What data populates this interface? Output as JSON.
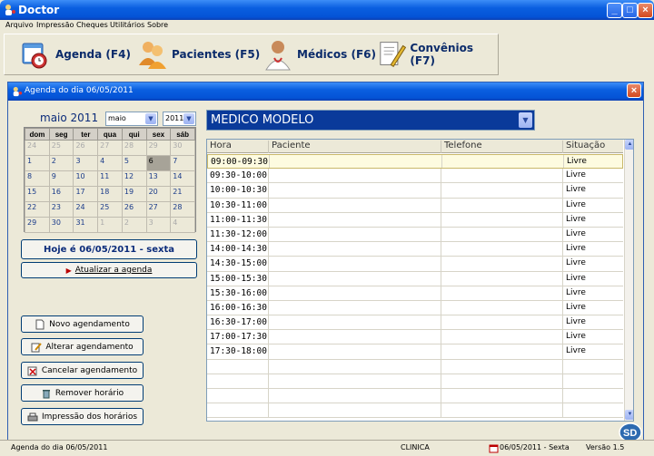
{
  "window": {
    "title": "Doctor"
  },
  "menu": [
    "Arquivo",
    "Impressão",
    "Cheques",
    "Utilitários",
    "Sobre"
  ],
  "toolbar": {
    "agenda": "Agenda (F4)",
    "pacientes": "Pacientes (F5)",
    "medicos": "Médicos (F6)",
    "convenios": "Convênios (F7)"
  },
  "dialog": {
    "title": "Agenda do dia 06/05/2011",
    "month_label": "maio 2011",
    "month_select": "maio",
    "year_select": "2011",
    "weekdays": [
      "dom",
      "seg",
      "ter",
      "qua",
      "qui",
      "sex",
      "sáb"
    ],
    "weeks": [
      [
        "24",
        "25",
        "26",
        "27",
        "28",
        "29",
        "30"
      ],
      [
        "1",
        "2",
        "3",
        "4",
        "5",
        "6",
        "7"
      ],
      [
        "8",
        "9",
        "10",
        "11",
        "12",
        "13",
        "14"
      ],
      [
        "15",
        "16",
        "17",
        "18",
        "19",
        "20",
        "21"
      ],
      [
        "22",
        "23",
        "24",
        "25",
        "26",
        "27",
        "28"
      ],
      [
        "29",
        "30",
        "31",
        "1",
        "2",
        "3",
        "4"
      ]
    ],
    "today": "Hoje é 06/05/2011 - sexta",
    "refresh": "Atualizar a agenda",
    "buttons": {
      "new": "Novo agendamento",
      "edit": "Alterar agendamento",
      "cancel": "Cancelar agendamento",
      "remove": "Remover horário",
      "print": "Impressão dos horários"
    },
    "doctor": "MEDICO MODELO",
    "columns": [
      "Hora",
      "Paciente",
      "Telefone",
      "Situação"
    ],
    "rows": [
      {
        "hora": "09:00-09:30",
        "situacao": "Livre"
      },
      {
        "hora": "09:30-10:00",
        "situacao": "Livre"
      },
      {
        "hora": "10:00-10:30",
        "situacao": "Livre"
      },
      {
        "hora": "10:30-11:00",
        "situacao": "Livre"
      },
      {
        "hora": "11:00-11:30",
        "situacao": "Livre"
      },
      {
        "hora": "11:30-12:00",
        "situacao": "Livre"
      },
      {
        "hora": "14:00-14:30",
        "situacao": "Livre"
      },
      {
        "hora": "14:30-15:00",
        "situacao": "Livre"
      },
      {
        "hora": "15:00-15:30",
        "situacao": "Livre"
      },
      {
        "hora": "15:30-16:00",
        "situacao": "Livre"
      },
      {
        "hora": "16:00-16:30",
        "situacao": "Livre"
      },
      {
        "hora": "16:30-17:00",
        "situacao": "Livre"
      },
      {
        "hora": "17:00-17:30",
        "situacao": "Livre"
      },
      {
        "hora": "17:30-18:00",
        "situacao": "Livre"
      }
    ]
  },
  "status": {
    "left": "Agenda do dia 06/05/2011",
    "clinic": "CLINICA",
    "date": "06/05/2011 - Sexta",
    "version": "Versão 1.5"
  }
}
